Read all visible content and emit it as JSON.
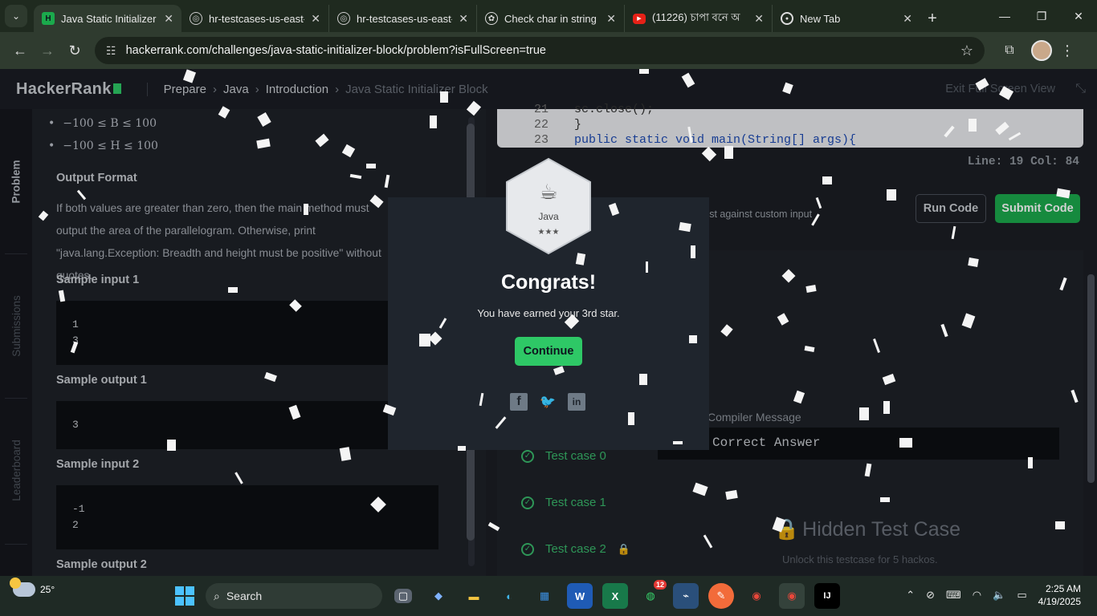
{
  "browser": {
    "tabs": [
      {
        "title": "Java Static Initializer B",
        "favicon": "hackerrank-icon",
        "active": true
      },
      {
        "title": "hr-testcases-us-east-",
        "favicon": "globe-icon",
        "active": false
      },
      {
        "title": "hr-testcases-us-east-",
        "favicon": "globe-icon",
        "active": false
      },
      {
        "title": "Check char in string",
        "favicon": "chatgpt-icon",
        "active": false
      },
      {
        "title": "(11226) চাপা বনে অ",
        "favicon": "youtube-icon",
        "active": false
      },
      {
        "title": "New Tab",
        "favicon": "chrome-icon",
        "active": false
      }
    ],
    "url": "hackerrank.com/challenges/java-static-initializer-block/problem?isFullScreen=true"
  },
  "header": {
    "logo": "HackerRank",
    "breadcrumbs": [
      "Prepare",
      "Java",
      "Introduction",
      "Java Static Initializer Block"
    ],
    "exit_fullscreen": "Exit Full Screen View"
  },
  "side_tabs": [
    "Problem",
    "Submissions",
    "Leaderboard"
  ],
  "problem": {
    "constraints": [
      "−100 ≤ B ≤ 100",
      "−100 ≤ H ≤ 100"
    ],
    "output_format_title": "Output Format",
    "output_format_text": "If both values are greater than zero, then the main method must output the area of the parallelogram. Otherwise, print \"java.lang.Exception: Breadth and height must be positive\" without quotes.",
    "sample_input_1_title": "Sample input 1",
    "sample_input_1": [
      "1",
      "3"
    ],
    "sample_output_1_title": "Sample output 1",
    "sample_output_1": [
      "3"
    ],
    "sample_input_2_title": "Sample input 2",
    "sample_input_2": [
      "-1",
      "2"
    ],
    "sample_output_2_title": "Sample output 2"
  },
  "editor": {
    "lines": [
      {
        "num": "21",
        "code": "  sc.close();"
      },
      {
        "num": "22",
        "code": "}"
      },
      {
        "num": "23",
        "code": "public static void main(String[] args){"
      }
    ],
    "status": "Line: 19 Col: 84",
    "custom_input_label": "Test against custom input",
    "run_label": "Run Code",
    "submit_label": "Submit Code"
  },
  "results": {
    "test_cases": [
      "Test case 0",
      "Test case 1",
      "Test case 2"
    ],
    "message_label": "Compiler Message",
    "answer": "Correct Answer",
    "hidden_title": "Hidden Test Case",
    "hidden_sub": "Unlock this testcase for 5 hackos."
  },
  "modal": {
    "badge_label": "Java",
    "badge_stars": "★★★",
    "title": "Congrats!",
    "message": "You have earned your 3rd star.",
    "continue_label": "Continue"
  },
  "taskbar": {
    "temperature": "25°",
    "search_placeholder": "Search",
    "whatsapp_badge": "12",
    "time": "2:25 AM",
    "date": "4/19/2025"
  },
  "colors": {
    "accent_green": "#2ec866",
    "submit_green": "#1ba94c",
    "bg_dark": "#1e2128"
  }
}
